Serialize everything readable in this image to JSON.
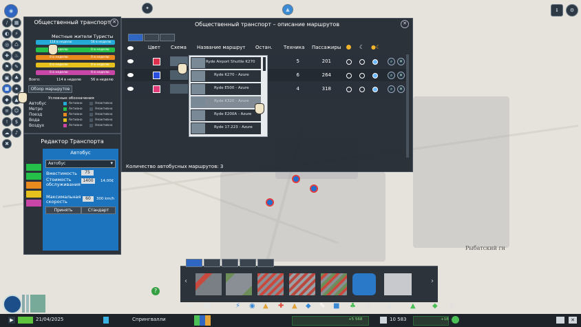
{
  "top_icons": [
    "gear-icon",
    "info-icon"
  ],
  "map": {
    "label_town": "Рыбатский гн"
  },
  "public_transport_panel": {
    "title": "Общественный транспорт",
    "column_headers": "Местные жители Туристы",
    "legend_rows": [
      {
        "left": "114 в неделю",
        "right": "56 в неделю",
        "color": "#25a9d6"
      },
      {
        "left": "0 в неделю",
        "right": "0 в неделю",
        "color": "#24c04a"
      },
      {
        "left": "0 в неделю",
        "right": "0 в неделю",
        "color": "#e98a1f"
      },
      {
        "left": "0 в неделю",
        "right": "0 в неделю",
        "color": "#e6c11d"
      },
      {
        "left": "0 в неделю",
        "right": "0 в неделю",
        "color": "#c746a6"
      }
    ],
    "total_label": "Всего:",
    "total_left": "114 в неделю",
    "total_right": "56 в неделю",
    "overview_button": "Обзор маршрутов",
    "conditions_title": "Условные обозначения",
    "conditions": [
      {
        "label": "Автобус",
        "color": "#25a9d6",
        "status_active": "Активно",
        "status_inactive": "Неактивно"
      },
      {
        "label": "Метро",
        "color": "#24c04a",
        "status_active": "Активно",
        "status_inactive": "Неактивно"
      },
      {
        "label": "Поезд",
        "color": "#e98a1f",
        "status_active": "Активно",
        "status_inactive": "Неактивно"
      },
      {
        "label": "Вода",
        "color": "#e6c11d",
        "status_active": "Активно",
        "status_inactive": "Неактивно"
      },
      {
        "label": "Воздух",
        "color": "#c746a6",
        "status_active": "Активно",
        "status_inactive": "Неактивно"
      }
    ]
  },
  "editor": {
    "title": "Редактор Транспорта",
    "subtitle": "Автобус",
    "type_value": "Автобус",
    "capacity_label": "Вместимость",
    "capacity_value": "75",
    "cost_label": "Стоимость обслуживания",
    "cost_value": "1400",
    "cost_suffix": "14,00₵",
    "speed_label": "Максимальная скорость",
    "speed_value": "60",
    "speed_suffix": "300 km/h",
    "accept_button": "Принять",
    "standard_button": "Стандарт"
  },
  "routes_window": {
    "title": "Общественный транспорт – описание маршрутов",
    "headers": {
      "color": "Цвет",
      "scheme": "Схема",
      "route_name": "Название маршрут",
      "stops": "Остан.",
      "vehicles": "Техника",
      "passengers": "Пассажиры"
    },
    "rows": [
      {
        "color": "#e0304f",
        "vehicles": "5",
        "passengers": "201"
      },
      {
        "color": "#2a4ee0",
        "vehicles": "6",
        "passengers": "264"
      },
      {
        "color": "#e23c7a",
        "vehicles": "4",
        "passengers": "318"
      }
    ],
    "footer": "Количество автобусных маршрутов: 3"
  },
  "dropdown": {
    "items": [
      "Ryde Airport Shuttle K270",
      "Ryde K270 - Azure",
      "Ryde E500 - Azure",
      "Ryde K320 - Azure",
      "Ryde E200A - Azure",
      "Ryde 17.223 - Azure"
    ]
  },
  "bottom_bar": {
    "date": "21/04/2025",
    "city": "Спрингвалли",
    "income": "+5 568",
    "population": "10 583",
    "growth": "+18"
  }
}
